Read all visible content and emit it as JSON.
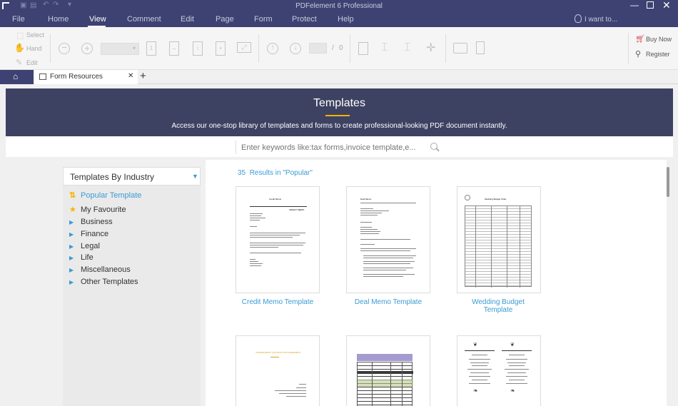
{
  "window": {
    "title": "PDFelement 6 Professional"
  },
  "menu": {
    "items": [
      "File",
      "Home",
      "View",
      "Comment",
      "Edit",
      "Page",
      "Form",
      "Protect",
      "Help"
    ],
    "active": "View",
    "search_placeholder": "I want to..."
  },
  "toolbar": {
    "select": "Select",
    "hand": "Hand",
    "edit": "Edit",
    "page_sep": "/",
    "page_total": "0",
    "buy_now": "Buy Now",
    "register": "Register"
  },
  "tabs": {
    "current": "Form Resources"
  },
  "banner": {
    "title": "Templates",
    "subtitle": "Access our one-stop library of templates and forms to create professional-looking PDF document instantly."
  },
  "search": {
    "placeholder": "Enter keywords like:tax forms,invoice template,e..."
  },
  "sidebar": {
    "dropdown": "Templates By Industry",
    "items": [
      {
        "label": "Popular Template",
        "icon": "popular-icon",
        "active": true
      },
      {
        "label": "My Favourite",
        "icon": "star-icon"
      },
      {
        "label": "Business",
        "icon": "triangle-right-icon"
      },
      {
        "label": "Finance",
        "icon": "triangle-right-icon"
      },
      {
        "label": "Legal",
        "icon": "triangle-right-icon"
      },
      {
        "label": "Life",
        "icon": "triangle-right-icon"
      },
      {
        "label": "Miscellaneous",
        "icon": "triangle-right-icon"
      },
      {
        "label": "Other Templates",
        "icon": "triangle-right-icon"
      }
    ]
  },
  "results": {
    "count": "35",
    "text": "Results in \"Popular\""
  },
  "templates": [
    {
      "label": "Credit Memo Template",
      "doc_title": "Credit Memo",
      "doc_heading": "CREDIT MEMO"
    },
    {
      "label": "Deal Memo Template",
      "doc_title": "Deal Memo"
    },
    {
      "label": "Wedding Budget Template",
      "doc_title": "Wedding Budget Chart"
    },
    {
      "label": "",
      "doc_title": "INDEPENDENT CONTRACTOR AGREEMENT"
    },
    {
      "label": ""
    },
    {
      "label": ""
    }
  ],
  "colors": {
    "brand": "#3d4272",
    "banner": "#3d4262",
    "accent": "#f5b400",
    "link": "#3a9bd3",
    "buy": "#d9534f"
  }
}
